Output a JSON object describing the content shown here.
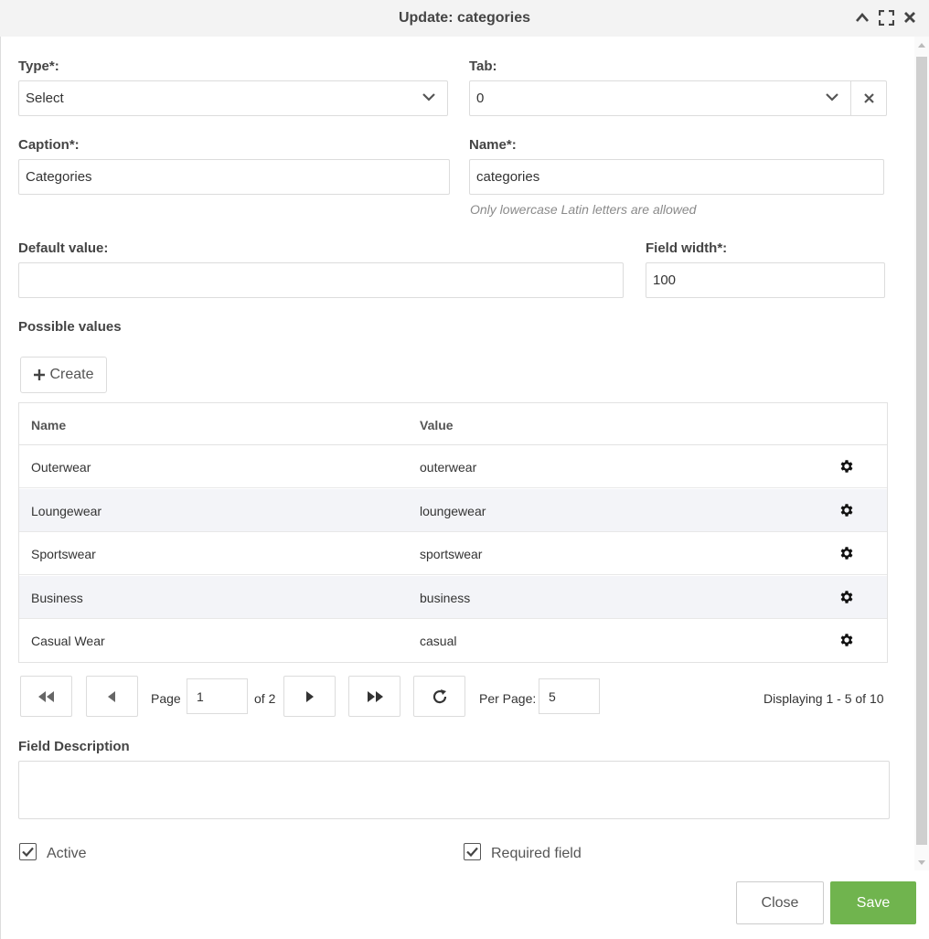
{
  "dialog": {
    "title": "Update: categories",
    "icons": [
      "chevron-up-icon",
      "fullscreen-icon",
      "close-icon"
    ]
  },
  "form": {
    "type": {
      "label": "Type*:",
      "value": "Select"
    },
    "tab": {
      "label": "Tab:",
      "value": "0"
    },
    "caption": {
      "label": "Caption*:",
      "value": "Categories"
    },
    "name": {
      "label": "Name*:",
      "value": "categories",
      "hint": "Only lowercase Latin letters are allowed"
    },
    "default_value": {
      "label": "Default value:",
      "value": ""
    },
    "field_width": {
      "label": "Field width*:",
      "value": "100"
    },
    "possible_values_label": "Possible values",
    "create_label": "Create"
  },
  "grid": {
    "columns": [
      "Name",
      "Value"
    ],
    "rows": [
      {
        "name": "Outerwear",
        "value": "outerwear"
      },
      {
        "name": "Loungewear",
        "value": "loungewear"
      },
      {
        "name": "Sportswear",
        "value": "sportswear"
      },
      {
        "name": "Business",
        "value": "business"
      },
      {
        "name": "Casual Wear",
        "value": "casual"
      }
    ]
  },
  "pagination": {
    "page_label": "Page",
    "page": "1",
    "of_label": "of 2",
    "per_page_label": "Per Page:",
    "per_page": "5",
    "displaying": "Displaying 1 - 5 of 10"
  },
  "description": {
    "label": "Field Description",
    "value": ""
  },
  "checkboxes": {
    "active": {
      "label": "Active",
      "checked": true
    },
    "required": {
      "label": "Required field",
      "checked": true
    }
  },
  "footer": {
    "close_label": "Close",
    "save_label": "Save"
  },
  "colors": {
    "save": "#70b44e",
    "titlebar": "#f3f3f3",
    "row_alt": "#f3f4f8"
  }
}
